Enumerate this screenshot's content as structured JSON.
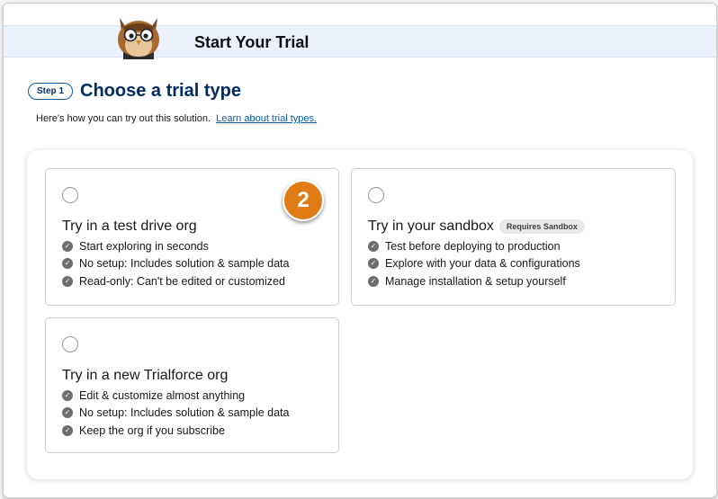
{
  "header": {
    "title": "Start Your Trial",
    "mascot": "owl-mascot-icon"
  },
  "step": {
    "badge": "Step 1",
    "title": "Choose a trial type"
  },
  "intro": {
    "text": "Here's how you can try out this solution.",
    "link": "Learn about trial types."
  },
  "callout": {
    "number": "2",
    "color": "#e07c15"
  },
  "cards": [
    {
      "title": "Try in a test drive org",
      "features": [
        "Start exploring in seconds",
        "No setup: Includes solution & sample data",
        "Read-only: Can't be edited or customized"
      ]
    },
    {
      "title": "Try in your sandbox",
      "tag": "Requires Sandbox",
      "features": [
        "Test before deploying to production",
        "Explore with your data & configurations",
        "Manage installation & setup yourself"
      ]
    },
    {
      "title": "Try in a new Trialforce org",
      "features": [
        "Edit & customize almost anything",
        "No setup: Includes solution & sample data",
        "Keep the org if you subscribe"
      ]
    }
  ],
  "colors": {
    "accent": "#0b5cab",
    "heading": "#032d60",
    "header_bg": "#eaf1fb"
  }
}
